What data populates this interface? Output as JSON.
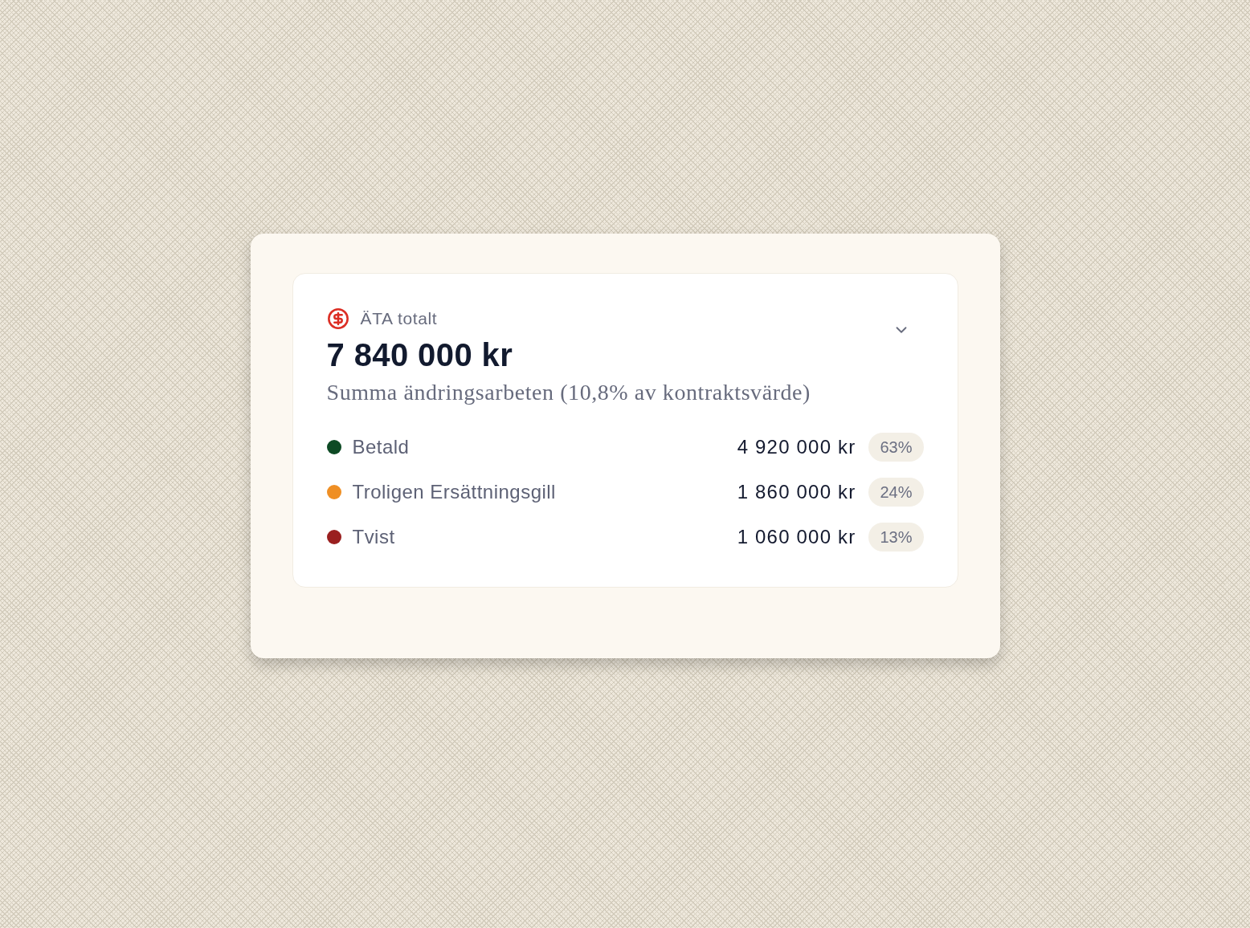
{
  "card": {
    "title": "ÄTA totalt",
    "total": "7 840 000 kr",
    "subtitle": "Summa ändringsarbeten (10,8% av kontraktsvärde)",
    "items": [
      {
        "label": "Betald",
        "amount": "4 920 000 kr",
        "share": "63%",
        "color": "#0d4a24"
      },
      {
        "label": "Troligen Ersättningsgill",
        "amount": "1 860 000 kr",
        "share": "24%",
        "color": "#ef8f24"
      },
      {
        "label": "Tvist",
        "amount": "1 060 000 kr",
        "share": "13%",
        "color": "#9a1f1f"
      }
    ]
  }
}
